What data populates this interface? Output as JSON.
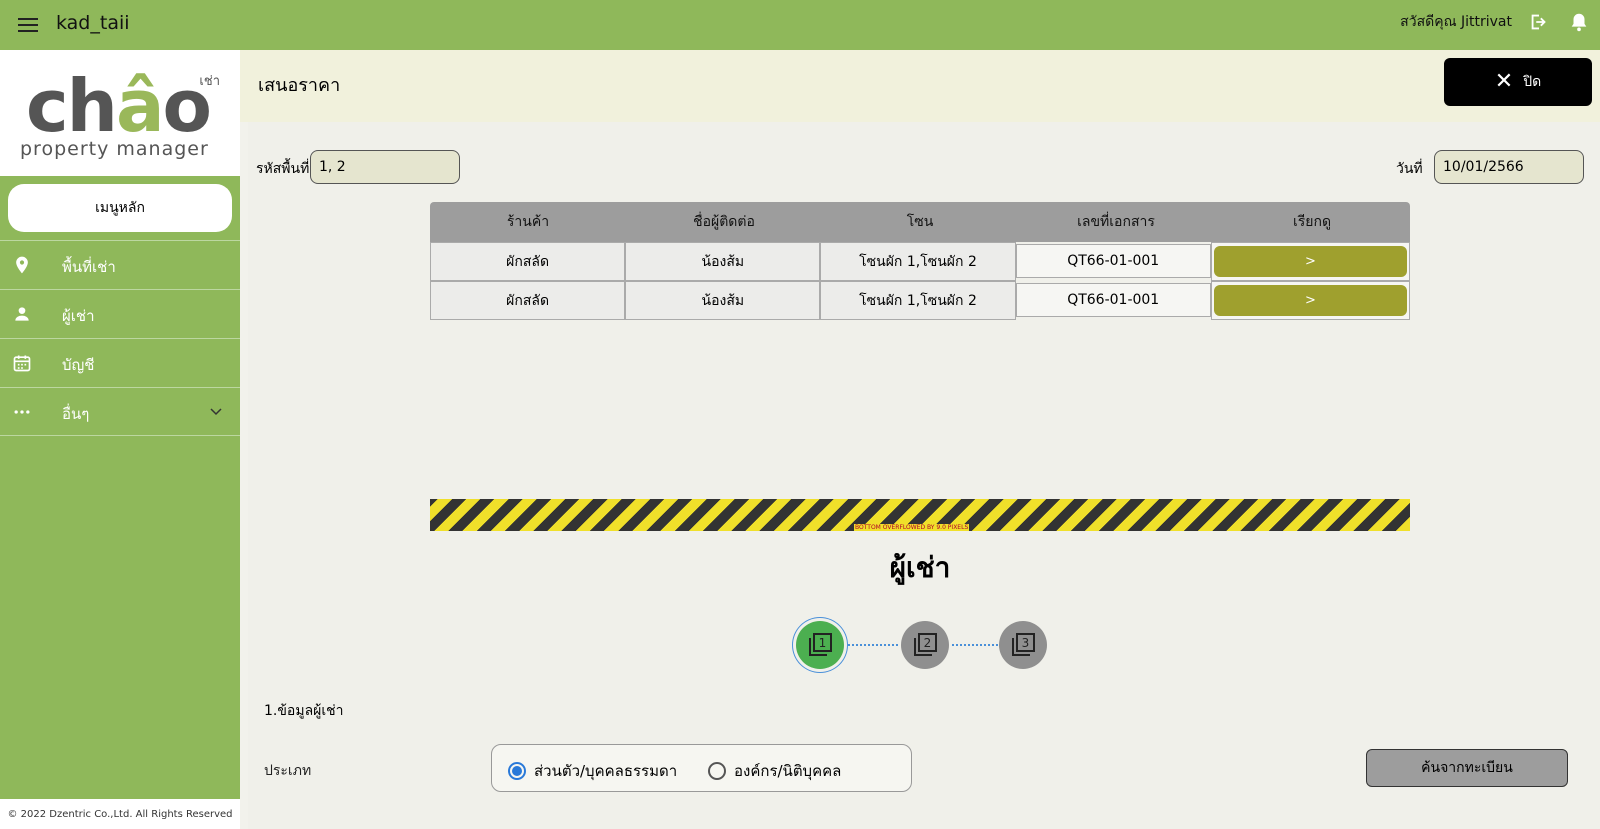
{
  "appbar": {
    "title": "kad_taii",
    "greeting": "สวัสดีคุณ Jittrivat"
  },
  "logo": {
    "main": "chao",
    "sub": "property   manager",
    "tag": "เช่า"
  },
  "sidebar": {
    "main_menu": "เมนูหลัก",
    "items": [
      {
        "label": "พื้นที่เช่า",
        "icon": "location-pin-icon"
      },
      {
        "label": "ผู้เช่า",
        "icon": "person-icon"
      },
      {
        "label": "บัญชี",
        "icon": "calendar-icon"
      },
      {
        "label": "อื่นๆ",
        "icon": "more-dots-icon"
      }
    ],
    "copyright": "© 2022  Dzentric Co.,Ltd. All Rights Reserved"
  },
  "page": {
    "title": "เสนอราคา",
    "close_label": "ปิด"
  },
  "filters": {
    "area_label": "รหัสพื้นที่",
    "area_value": "1, 2",
    "date_label": "วันที่",
    "date_value": "10/01/2566"
  },
  "table": {
    "headers": [
      "ร้านค้า",
      "ชื่อผู้ติดต่อ",
      "โซน",
      "เลขที่เอกสาร",
      "เรียกดู"
    ],
    "rows": [
      {
        "shop": "ผักสลัด",
        "contact": "น้องส้ม",
        "zone": "โซนผัก 1,โซนผัก 2",
        "doc": "QT66-01-001",
        "action": ">"
      },
      {
        "shop": "ผักสลัด",
        "contact": "น้องส้ม",
        "zone": "โซนผัก 1,โซนผัก 2",
        "doc": "QT66-01-001",
        "action": ">"
      }
    ]
  },
  "overflow_warning": "BOTTOM OVERFLOWED BY 9.0 PIXELS",
  "tenant": {
    "heading": "ผู้เช่า",
    "steps": [
      "1",
      "2",
      "3"
    ],
    "section_title": "1.ข้อมูลผู้เช่า",
    "type_label": "ประเภท",
    "options": [
      "ส่วนตัว/บุคคลธรรมดา",
      "องค์กร/นิติบุคคล"
    ],
    "search_button": "ค้นจากทะเบียน"
  },
  "colors": {
    "brand_green": "#8fb85a",
    "action_olive": "#9fa02e",
    "step_active": "#4caf50"
  }
}
